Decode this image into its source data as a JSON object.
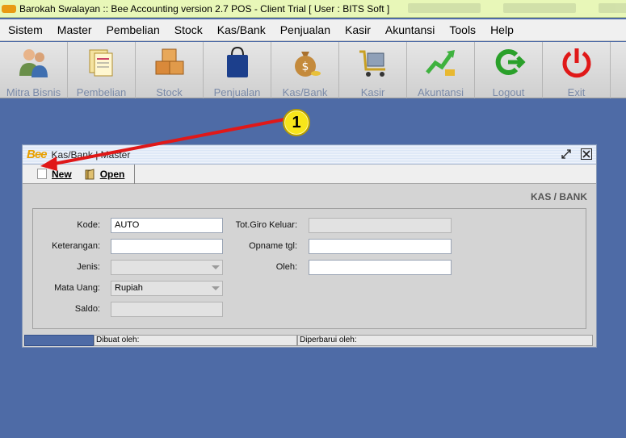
{
  "app": {
    "title": "Barokah Swalayan :: Bee Accounting version 2.7 POS - Client Trial [ User : BITS Soft ]"
  },
  "menu": [
    {
      "label": "Sistem"
    },
    {
      "label": "Master"
    },
    {
      "label": "Pembelian"
    },
    {
      "label": "Stock"
    },
    {
      "label": "Kas/Bank"
    },
    {
      "label": "Penjualan"
    },
    {
      "label": "Kasir"
    },
    {
      "label": "Akuntansi"
    },
    {
      "label": "Tools"
    },
    {
      "label": "Help"
    }
  ],
  "toolbar": [
    {
      "label": "Mitra Bisnis",
      "icon": "people-icon"
    },
    {
      "label": "Pembelian",
      "icon": "documents-icon"
    },
    {
      "label": "Stock",
      "icon": "boxes-icon"
    },
    {
      "label": "Penjualan",
      "icon": "shopping-bag-icon"
    },
    {
      "label": "Kas/Bank",
      "icon": "money-bag-icon"
    },
    {
      "label": "Kasir",
      "icon": "cart-icon"
    },
    {
      "label": "Akuntansi",
      "icon": "growth-chart-icon"
    },
    {
      "label": "Logout",
      "icon": "logout-icon"
    },
    {
      "label": "Exit",
      "icon": "power-icon"
    }
  ],
  "annotation": {
    "badge": "1"
  },
  "window": {
    "logo": "Bee",
    "title": "Kas/Bank | Master",
    "new_label": "New",
    "open_label": "Open",
    "section_title": "KAS / BANK"
  },
  "form": {
    "kode_label": "Kode:",
    "kode_value": "AUTO",
    "keterangan_label": "Keterangan:",
    "keterangan_value": "",
    "jenis_label": "Jenis:",
    "jenis_value": "",
    "mata_uang_label": "Mata Uang:",
    "mata_uang_value": "Rupiah",
    "saldo_label": "Saldo:",
    "saldo_value": "",
    "tot_giro_label": "Tot.Giro Keluar:",
    "tot_giro_value": "",
    "opname_label": "Opname tgl:",
    "opname_value": "",
    "oleh_label": "Oleh:",
    "oleh_value": ""
  },
  "status": {
    "dibuat": "Dibuat oleh:",
    "diperbarui": "Diperbarui oleh:"
  },
  "colors": {
    "desktop": "#4e6ba6",
    "titlebar": "#e8f7b8",
    "annotation_red": "#e01818",
    "badge_yellow": "#f7e51a"
  }
}
